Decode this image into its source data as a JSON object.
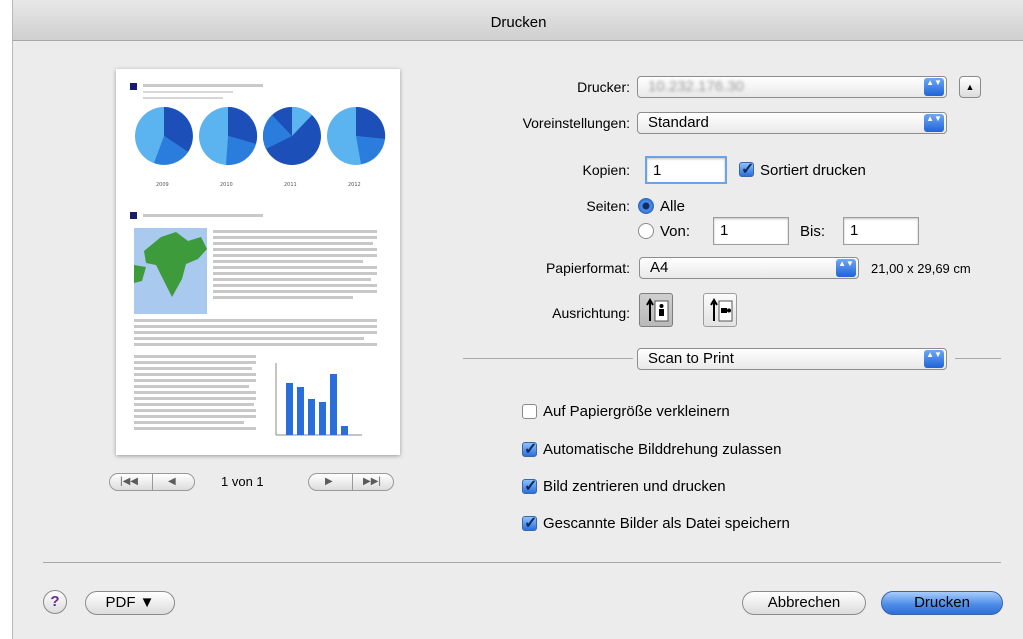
{
  "window": {
    "title": "Drucken"
  },
  "preview": {
    "page_indicator": "1 von 1",
    "chart_years": [
      "2009",
      "2010",
      "2011",
      "2012"
    ]
  },
  "printer": {
    "label": "Drucker:",
    "value": "10.232.176.30"
  },
  "presets": {
    "label": "Voreinstellungen:",
    "value": "Standard"
  },
  "copies": {
    "label": "Kopien:",
    "value": "1",
    "collate_label": "Sortiert drucken",
    "collate_checked": true
  },
  "pages": {
    "label": "Seiten:",
    "all_label": "Alle",
    "from_label": "Von:",
    "from_value": "1",
    "to_label": "Bis:",
    "to_value": "1"
  },
  "paper": {
    "label": "Papierformat:",
    "value": "A4",
    "size_text": "21,00 x 29,69 cm"
  },
  "orientation": {
    "label": "Ausrichtung:"
  },
  "section": {
    "value": "Scan to Print"
  },
  "options": [
    {
      "label": "Auf Papiergröße verkleinern",
      "checked": false
    },
    {
      "label": "Automatische Bilddrehung zulassen",
      "checked": true
    },
    {
      "label": "Bild zentrieren und drucken",
      "checked": true
    },
    {
      "label": "Gescannte Bilder als Datei speichern",
      "checked": true
    }
  ],
  "footer": {
    "help": "?",
    "pdf": "PDF ▼",
    "cancel": "Abbrechen",
    "print": "Drucken"
  },
  "icons": {
    "up": "▲",
    "stepper": "▲▼",
    "first": "|◀◀",
    "prev": "◀",
    "next": "▶",
    "last": "▶▶|"
  }
}
